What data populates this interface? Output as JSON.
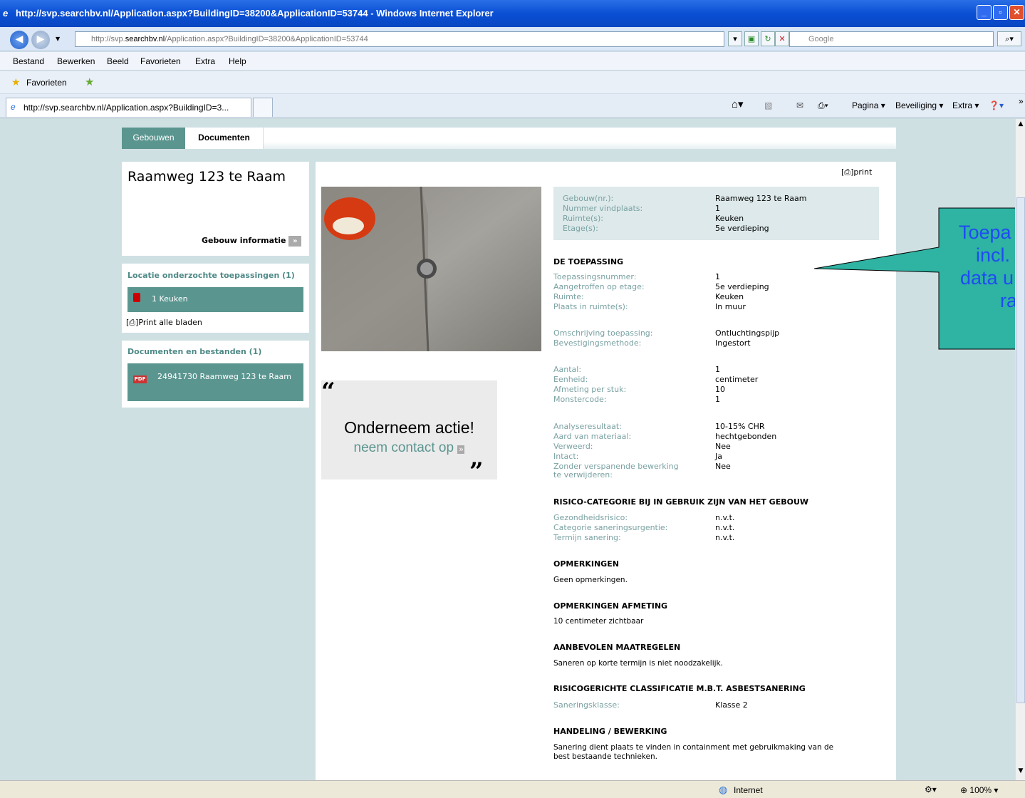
{
  "browser": {
    "title": "http://svp.searchbv.nl/Application.aspx?BuildingID=38200&ApplicationID=53744 - Windows Internet Explorer",
    "address_prefix": "http://svp.",
    "address_host": "searchbv.nl",
    "address_path": "/Application.aspx?BuildingID=38200&ApplicationID=53744",
    "search_placeholder": "Google",
    "menu": [
      "Bestand",
      "Bewerken",
      "Beeld",
      "Favorieten",
      "Extra",
      "Help"
    ],
    "favorites_label": "Favorieten",
    "tab_label": "http://svp.searchbv.nl/Application.aspx?BuildingID=3...",
    "commands": {
      "page": "Pagina",
      "security": "Beveiliging",
      "extra": "Extra"
    },
    "status": {
      "zone": "Internet",
      "zoom": "100%"
    }
  },
  "site": {
    "tabs": {
      "buildings": "Gebouwen",
      "documents": "Documenten"
    },
    "building": {
      "title": "Raamweg 123 te Raam",
      "info_link": "Gebouw informatie"
    },
    "locations": {
      "heading": "Locatie onderzochte toepassingen (1)",
      "item": "1 Keuken",
      "print_all": "Print alle bladen"
    },
    "documents": {
      "heading": "Documenten en bestanden (1)",
      "item": "24941730 Raamweg 123 te Raam"
    },
    "action": {
      "title": "Onderneem actie!",
      "link": "neem contact op"
    },
    "print": "print",
    "summary": [
      {
        "k": "Gebouw(nr.):",
        "v": "Raamweg 123 te Raam"
      },
      {
        "k": "Nummer vindplaats:",
        "v": "1"
      },
      {
        "k": "Ruimte(s):",
        "v": "Keuken"
      },
      {
        "k": "Etage(s):",
        "v": "5e verdieping"
      }
    ],
    "toepassing": {
      "heading": "DE TOEPASSING",
      "group1": [
        {
          "k": "Toepassingsnummer:",
          "v": "1"
        },
        {
          "k": "Aangetroffen op etage:",
          "v": "5e verdieping"
        },
        {
          "k": "Ruimte:",
          "v": "Keuken"
        },
        {
          "k": "Plaats in ruimte(s):",
          "v": "In muur"
        }
      ],
      "group2": [
        {
          "k": "Omschrijving toepassing:",
          "v": "Ontluchtingspijp"
        },
        {
          "k": "Bevestigingsmethode:",
          "v": "Ingestort"
        }
      ],
      "group3": [
        {
          "k": "Aantal:",
          "v": "1"
        },
        {
          "k": "Eenheid:",
          "v": "centimeter"
        },
        {
          "k": "Afmeting per stuk:",
          "v": "10"
        },
        {
          "k": "Monstercode:",
          "v": "1"
        }
      ],
      "group4": [
        {
          "k": "Analyseresultaat:",
          "v": "10-15% CHR"
        },
        {
          "k": "Aard van materiaal:",
          "v": "hechtgebonden"
        },
        {
          "k": "Verweerd:",
          "v": "Nee"
        },
        {
          "k": "Intact:",
          "v": "Ja"
        },
        {
          "k": "Zonder verspanende bewerking",
          "v": "Nee"
        },
        {
          "k": "te verwijderen:",
          "v": ""
        }
      ]
    },
    "risico": {
      "heading": "RISICO-CATEGORIE BIJ IN GEBRUIK ZIJN VAN HET GEBOUW",
      "rows": [
        {
          "k": "Gezondheidsrisico:",
          "v": "n.v.t."
        },
        {
          "k": "Categorie saneringsurgentie:",
          "v": "n.v.t."
        },
        {
          "k": "Termijn sanering:",
          "v": "n.v.t."
        }
      ]
    },
    "opmerkingen": {
      "heading": "OPMERKINGEN",
      "text": "Geen opmerkingen."
    },
    "opmerkingen_afmeting": {
      "heading": "OPMERKINGEN AFMETING",
      "text": "10 centimeter zichtbaar"
    },
    "maatregelen": {
      "heading": "AANBEVOLEN MAATREGELEN",
      "text": "Saneren op korte termijn is niet noodzakelijk."
    },
    "classificatie": {
      "heading": "RISICOGERICHTE CLASSIFICATIE M.B.T. ASBESTSANERING",
      "k": "Saneringsklasse:",
      "v": "Klasse 2"
    },
    "handeling": {
      "heading": "HANDELING / BEWERKING",
      "line1": "Sanering dient plaats te vinden in containment met gebruikmaking van de",
      "line2": "best bestaande technieken."
    }
  },
  "callout": {
    "line1": "Toepa",
    "line2": "incl.",
    "line3": "data u",
    "line4": "ra",
    "fill": "#2fb3a3"
  }
}
